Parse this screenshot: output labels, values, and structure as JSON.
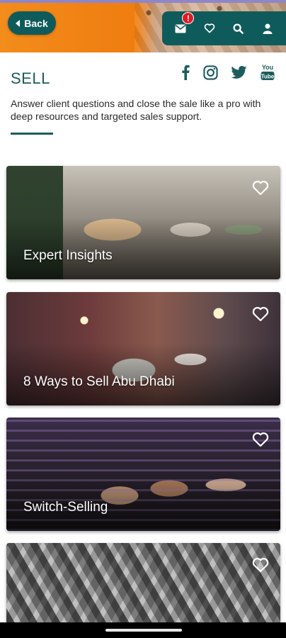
{
  "header": {
    "back_label": "Back",
    "notification_count": "!",
    "icons": [
      "mail-icon",
      "heart-icon",
      "search-icon",
      "user-icon"
    ],
    "colors": {
      "accent": "#0f5b5b",
      "orange": "#f07f12",
      "badge": "#e21b23",
      "stripe": "#8e86c9"
    }
  },
  "page": {
    "title": "SELL",
    "description": "Answer client questions and close the sale like a pro with deep resources and targeted sales support.",
    "social": [
      "facebook-icon",
      "instagram-icon",
      "twitter-icon",
      "youtube-icon"
    ],
    "youtube_text": "You Tube"
  },
  "cards": [
    {
      "label": "Expert Insights"
    },
    {
      "label": "8 Ways to Sell Abu Dhabi"
    },
    {
      "label": "Switch-Selling"
    },
    {
      "label": ""
    }
  ]
}
